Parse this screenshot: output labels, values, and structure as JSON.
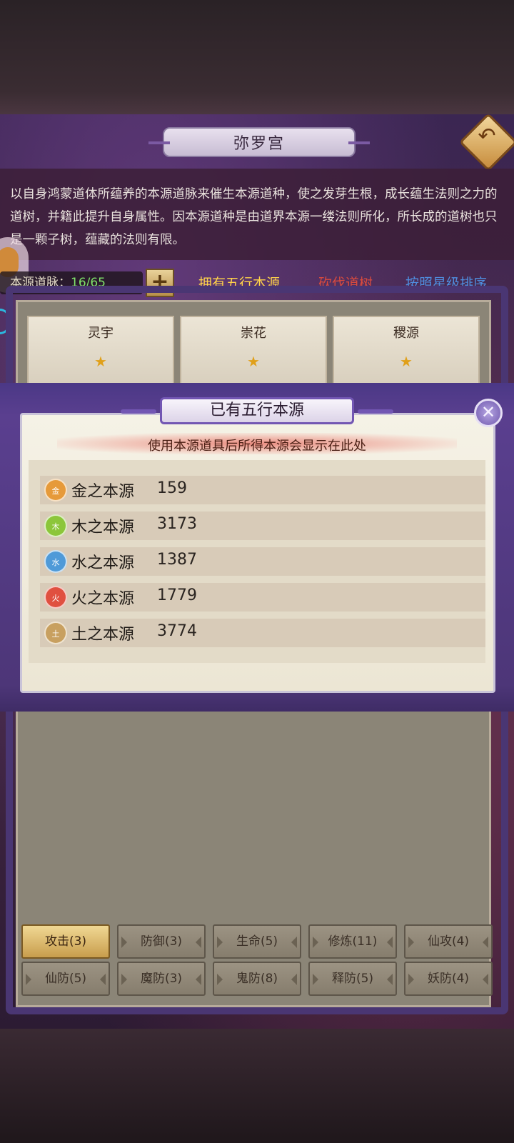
{
  "header": {
    "title": "弥罗宫",
    "back_icon": "back-arrow-icon"
  },
  "description": "以自身鸿蒙道体所蕴养的本源道脉来催生本源道种，使之发芽生根，成长蕴生法则之力的道树，并籍此提升自身属性。因本源道种是由道界本源一缕法则所化，所长成的道树也只是一颗子树，蕴藏的法则有限。",
  "vein": {
    "label": "本源道脉：",
    "value": "16/65",
    "plus_label": "+"
  },
  "links": {
    "own_sources": "拥有五行本源",
    "cut_tree": "砍伐道树",
    "sort_by_star": "按照星级排序"
  },
  "tree_cards": [
    {
      "name": "灵宇",
      "star": "★"
    },
    {
      "name": "崇花",
      "star": "★"
    },
    {
      "name": "稷源",
      "star": "★"
    }
  ],
  "modal": {
    "title": "已有五行本源",
    "close_label": "✕",
    "hint": "使用本源道具后所得本源会显示在此处",
    "sources": [
      {
        "icon_text": "金",
        "name": "金之本源",
        "value": "159",
        "color": "#e69a3a"
      },
      {
        "icon_text": "木",
        "name": "木之本源",
        "value": "3173",
        "color": "#8cc63a"
      },
      {
        "icon_text": "水",
        "name": "水之本源",
        "value": "1387",
        "color": "#4f9ad8"
      },
      {
        "icon_text": "火",
        "name": "火之本源",
        "value": "1779",
        "color": "#e05040"
      },
      {
        "icon_text": "土",
        "name": "土之本源",
        "value": "3774",
        "color": "#c8a060"
      }
    ]
  },
  "tabs": [
    {
      "label": "攻击(3)",
      "active": true
    },
    {
      "label": "防御(3)"
    },
    {
      "label": "生命(5)"
    },
    {
      "label": "修炼(11)"
    },
    {
      "label": "仙攻(4)"
    },
    {
      "label": "仙防(5)"
    },
    {
      "label": "魔防(3)"
    },
    {
      "label": "鬼防(8)"
    },
    {
      "label": "释防(5)"
    },
    {
      "label": "妖防(4)"
    }
  ]
}
